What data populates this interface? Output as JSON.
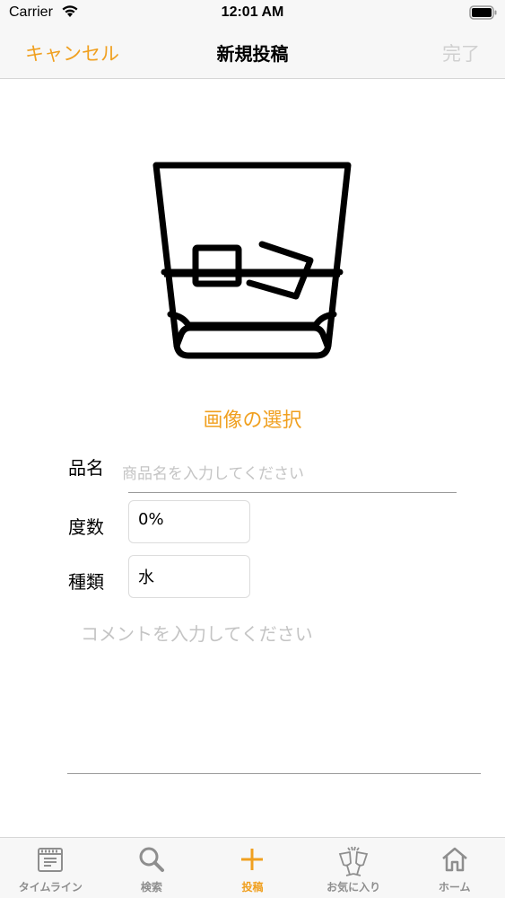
{
  "status_bar": {
    "carrier": "Carrier",
    "time": "12:01 AM"
  },
  "nav": {
    "cancel_label": "キャンセル",
    "title": "新規投稿",
    "done_label": "完了"
  },
  "image": {
    "icon": "whisky-glass-icon",
    "select_label": "画像の選択"
  },
  "form": {
    "name_label": "品名",
    "name_placeholder": "商品名を入力してください",
    "abv_label": "度数",
    "abv_value": "0%",
    "type_label": "種類",
    "type_value": "水",
    "comment_placeholder": "コメントを入力してください"
  },
  "tabs": [
    {
      "label": "タイムライン",
      "icon": "timeline-icon"
    },
    {
      "label": "検索",
      "icon": "search-icon"
    },
    {
      "label": "投稿",
      "icon": "plus-icon"
    },
    {
      "label": "お気に入り",
      "icon": "cheers-icon"
    },
    {
      "label": "ホーム",
      "icon": "home-icon"
    }
  ],
  "colors": {
    "accent": "#f0a020",
    "disabled": "#d0d0d0",
    "placeholder": "#c4c4c4"
  }
}
